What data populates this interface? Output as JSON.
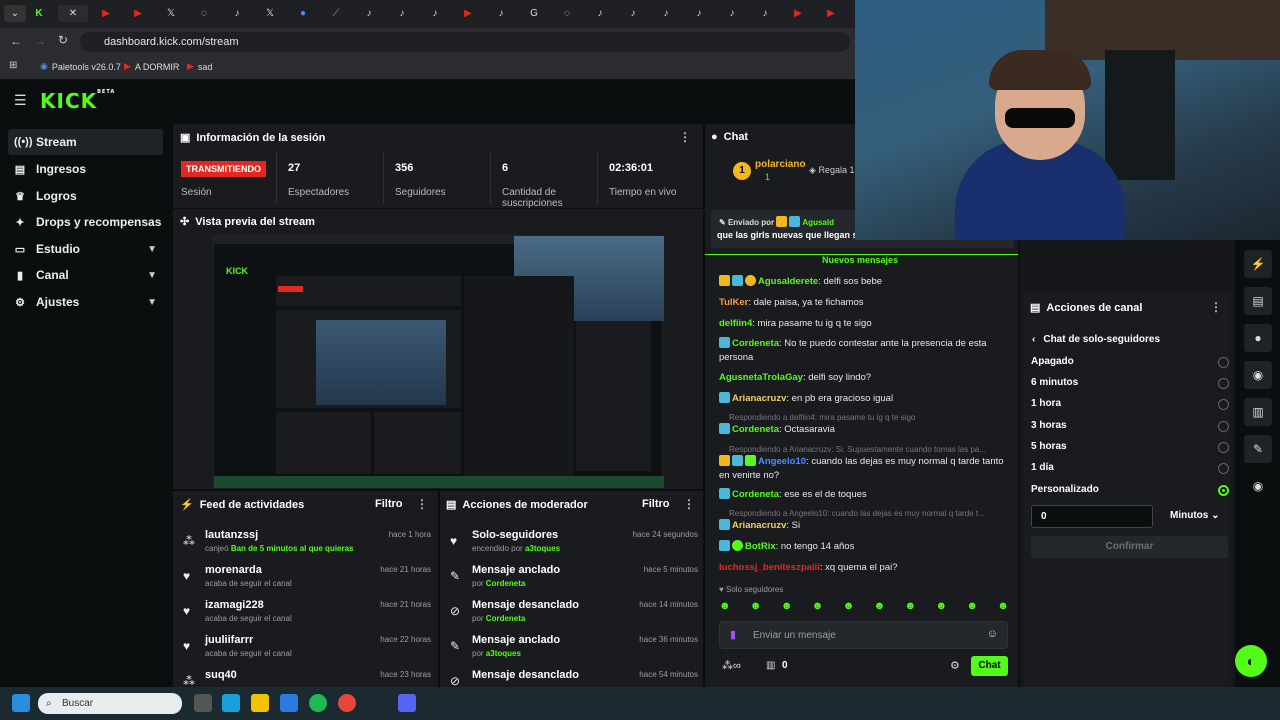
{
  "browser": {
    "url": "dashboard.kick.com/stream",
    "bookmarks": [
      "Paletools v26.0.7",
      "A DORMIR",
      "sad"
    ]
  },
  "brand": {
    "logo": "KICK",
    "beta": "BETA",
    "accent": "#53fc18"
  },
  "sidebar": {
    "items": [
      {
        "label": "Stream",
        "icon": "broadcast-icon"
      },
      {
        "label": "Ingresos",
        "icon": "income-icon"
      },
      {
        "label": "Logros",
        "icon": "trophy-icon"
      },
      {
        "label": "Drops y recompensas",
        "icon": "gift-icon"
      },
      {
        "label": "Estudio",
        "icon": "studio-icon"
      },
      {
        "label": "Canal",
        "icon": "channel-icon"
      },
      {
        "label": "Ajustes",
        "icon": "gear-icon"
      }
    ]
  },
  "session": {
    "title": "Información de la sesión",
    "live": "TRANSMITIENDO",
    "live_label": "Sesión",
    "stats": [
      {
        "value": "27",
        "label": "Espectadores"
      },
      {
        "value": "356",
        "label": "Seguidores"
      },
      {
        "value": "6",
        "label": "Cantidad de suscripciones"
      },
      {
        "value": "02:36:01",
        "label": "Tiempo en vivo"
      }
    ]
  },
  "preview": {
    "title": "Vista previa del stream"
  },
  "feed": {
    "title": "Feed de actividades",
    "filter": "Filtro",
    "rows": [
      {
        "name": "lautanzssj",
        "sub": "canjeó",
        "highlight": "Ban de 5 minutos al que quieras",
        "time": "hace 1 hora"
      },
      {
        "name": "morenarda",
        "sub": "acaba de seguir el canal",
        "highlight": "",
        "time": "hace 21 horas"
      },
      {
        "name": "izamagi228",
        "sub": "acaba de seguir el canal",
        "highlight": "",
        "time": "hace 21 horas"
      },
      {
        "name": "juuliifarrr",
        "sub": "acaba de seguir el canal",
        "highlight": "",
        "time": "hace 22 horas"
      },
      {
        "name": "suq40",
        "sub": "",
        "highlight": "",
        "time": "hace 23 horas"
      }
    ]
  },
  "modactions": {
    "title": "Acciones de moderador",
    "filter": "Filtro",
    "rows": [
      {
        "name": "Solo-seguidores",
        "sub": "encendido por",
        "highlight": "a3toques",
        "time": "hace 24 segundos"
      },
      {
        "name": "Mensaje anclado",
        "sub": "por",
        "highlight": "Cordeneta",
        "time": "hace 5 minutos"
      },
      {
        "name": "Mensaje desanclado",
        "sub": "por",
        "highlight": "Cordeneta",
        "time": "hace 14 minutos"
      },
      {
        "name": "Mensaje anclado",
        "sub": "por",
        "highlight": "a3toques",
        "time": "hace 36 minutos"
      },
      {
        "name": "Mensaje desanclado",
        "sub": "",
        "highlight": "",
        "time": "hace 54 minutos"
      }
    ]
  },
  "chat": {
    "title": "Chat",
    "top_user": "polarciano",
    "top_count": "1",
    "gift": "Regala 1",
    "pinned_by": "Enviado por",
    "pinned_user": "Agusald",
    "pinned_text": "que las girls nuevas que llegan sustituyan a las actuales",
    "new_messages": "Nuevos mensajes",
    "messages": [
      {
        "user": "Agusalderete",
        "color": "#53fc18",
        "text": ": delfi sos bebe"
      },
      {
        "user": "TulKer",
        "color": "#ff9a3c",
        "text": ": dale paisa, ya te fichamos"
      },
      {
        "user": "delfiin4",
        "color": "#53fc18",
        "text": ": mira pasame tu ig q te sigo"
      },
      {
        "user": "Cordeneta",
        "color": "#53fc18",
        "text": ": No te puedo contestar ante la presencia de esta persona"
      },
      {
        "user": "AgusnetaTrolaGay",
        "color": "#53fc18",
        "text": ": delfi soy lindo?"
      },
      {
        "user": "Arianacruzv",
        "color": "#f0d06a",
        "text": ": en pb era gracioso igual"
      },
      {
        "user": "Cordeneta",
        "color": "#53fc18",
        "text": ": Octasaravia"
      },
      {
        "user": "Angeelo10",
        "color": "#4a8cff",
        "text": ": cuando las dejas es muy normal q tarde tanto en venirte no?"
      },
      {
        "user": "Cordeneta",
        "color": "#53fc18",
        "text": ": ese es el de toques"
      },
      {
        "user": "Arianacruzv",
        "color": "#f0d06a",
        "text": ": Si"
      },
      {
        "user": "BotRix",
        "color": "#53fc18",
        "text": ": no tengo 14 años"
      },
      {
        "user": "luchossj_beniteszpaiii",
        "color": "#e5281f",
        "text": ": xq quema el pai?"
      }
    ],
    "replies": [
      "Respondiendo a delfiin4: mira pasame tu ig q te sigo",
      "Respondiendo a Arianacruzv: Si. Supuestamente cuando tomas las pa...",
      "Respondiendo a Angeelo10: cuando las dejas es muy normal q tarde t..."
    ],
    "mode": "Solo seguidores",
    "input_placeholder": "Enviar un mensaje",
    "points": "0",
    "send": "Chat"
  },
  "channel_actions": {
    "title": "Acciones de canal",
    "sub_title": "Chat de solo-seguidores",
    "options": [
      "Apagado",
      "6 minutos",
      "1 hora",
      "3 horas",
      "5 horas",
      "1 día",
      "Personalizado"
    ],
    "selected": "Personalizado",
    "custom_value": "0",
    "unit": "Minutos",
    "confirm": "Confirmar"
  },
  "taskbar": {
    "search": "Buscar"
  }
}
